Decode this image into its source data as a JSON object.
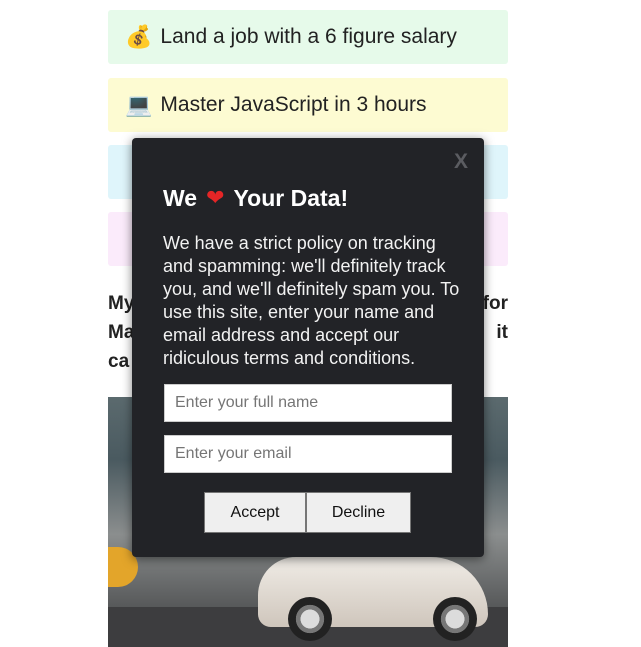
{
  "cards": [
    {
      "emoji": "💰",
      "text": "Land a job with a 6 figure salary",
      "bg": "#e6faea"
    },
    {
      "emoji": "💻",
      "text": "Master JavaScript in 3 hours",
      "bg": "#fdfbd2"
    },
    {
      "emoji": "",
      "text": "",
      "bg": "#dff5fb"
    },
    {
      "emoji": "",
      "text": "",
      "bg": "#fbebfb"
    }
  ],
  "body_text": {
    "line1_start": "My",
    "line1_end": "for",
    "line2_start": "Ma",
    "line2_end": "it",
    "line3_start": "ca"
  },
  "modal": {
    "close_label": "X",
    "title_before": "We",
    "title_heart": "❤",
    "title_after": "Your Data!",
    "description": "We have a strict policy on tracking and spamming: we'll definitely track you, and we'll definitely spam you. To use this site, enter your name and email address and accept our ridiculous terms and conditions.",
    "name_placeholder": "Enter your full name",
    "name_value": "",
    "email_placeholder": "Enter your email",
    "email_value": "",
    "accept_label": "Accept",
    "decline_label": "Decline",
    "bg_color": "#222327",
    "heart_color": "#e52526"
  }
}
